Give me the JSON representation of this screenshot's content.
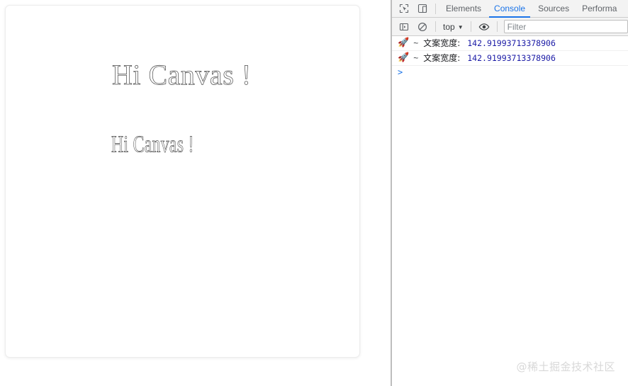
{
  "page": {
    "canvas": {
      "text_primary": "Hi Canvas !",
      "text_secondary": "Hi Canvas !"
    }
  },
  "devtools": {
    "toolbar_icons": [
      {
        "name": "inspect-element-icon",
        "title": "Inspect element"
      },
      {
        "name": "device-toolbar-icon",
        "title": "Toggle device toolbar"
      }
    ],
    "tabs": [
      {
        "id": "elements",
        "label": "Elements",
        "active": false
      },
      {
        "id": "console",
        "label": "Console",
        "active": true
      },
      {
        "id": "sources",
        "label": "Sources",
        "active": false
      },
      {
        "id": "performance",
        "label": "Performa",
        "active": false
      }
    ],
    "console_toolbar": {
      "sidebar_toggle_icon": "console-sidebar-icon",
      "clear_console_icon": "clear-console-icon",
      "context": "top",
      "context_caret": "▼",
      "live_expression_icon": "eye-icon",
      "filter_placeholder": "Filter",
      "filter_value": ""
    },
    "console_messages": [
      {
        "emoji": "🚀",
        "tilde": "~",
        "label": "文案宽度:",
        "value": "142.91993713378906"
      },
      {
        "emoji": "🚀",
        "tilde": "~",
        "label": "文案宽度:",
        "value": "142.91993713378906"
      }
    ],
    "console_prompt": {
      "caret": ">",
      "value": ""
    }
  },
  "watermark": {
    "text": "@稀土掘金技术社区"
  },
  "colors": {
    "accent_blue": "#1a73e8",
    "value_blue": "#1a1aa6",
    "toolbar_bg": "#f3f3f3",
    "border_gray": "#cdcdcd",
    "splitter_gray": "#bdbdbd",
    "watermark_gray": "#d8d8d8",
    "canvas_stroke": "#4a4a4a"
  }
}
